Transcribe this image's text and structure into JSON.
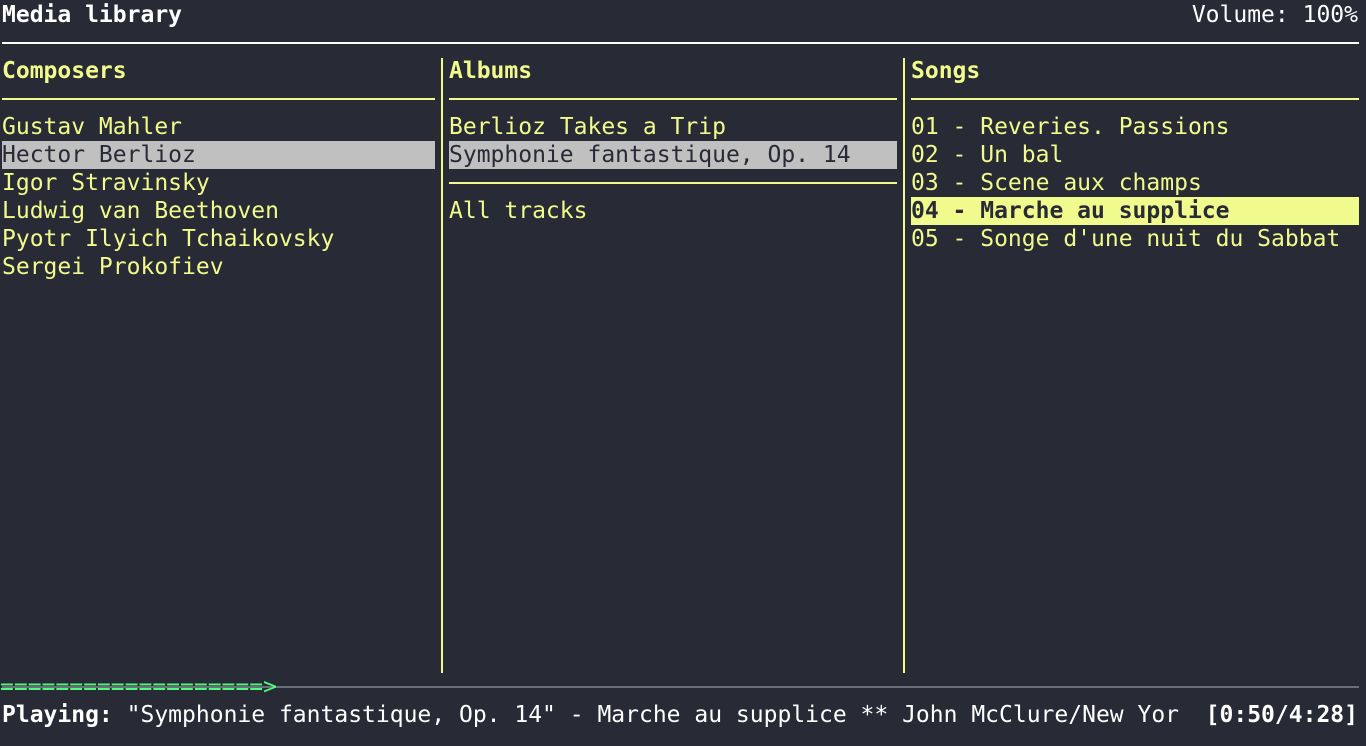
{
  "header": {
    "title": "Media library",
    "volume_label": "Volume:",
    "volume_value": "100%"
  },
  "columns": {
    "composers": {
      "title": "Composers",
      "items": [
        "Gustav Mahler",
        "Hector Berlioz",
        "Igor Stravinsky",
        "Ludwig van Beethoven",
        "Pyotr Ilyich Tchaikovsky",
        "Sergei Prokofiev"
      ],
      "selected_index": 1
    },
    "albums": {
      "title": "Albums",
      "items": [
        "Berlioz Takes a Trip",
        "Symphonie fantastique, Op. 14"
      ],
      "selected_index": 1,
      "all_tracks_label": "All tracks"
    },
    "songs": {
      "title": "Songs",
      "items": [
        "01 - Reveries. Passions",
        "02 - Un bal",
        "03 - Scene aux champs",
        "04 - Marche au supplice",
        "05 - Songe d'une nuit du Sabbat"
      ],
      "playing_index": 3
    }
  },
  "status": {
    "progress_bar": "===================>",
    "progress_fraction": 0.19,
    "playing_label": "Playing:",
    "playing_text": "\"Symphonie fantastique, Op. 14\" - Marche au supplice ** John McClure/New Yor",
    "time": "[0:50/4:28]"
  },
  "colors": {
    "background": "#282a36",
    "accent": "#f1fa8c",
    "selection": "#c0c0c0",
    "progress": "#50fa7b"
  }
}
